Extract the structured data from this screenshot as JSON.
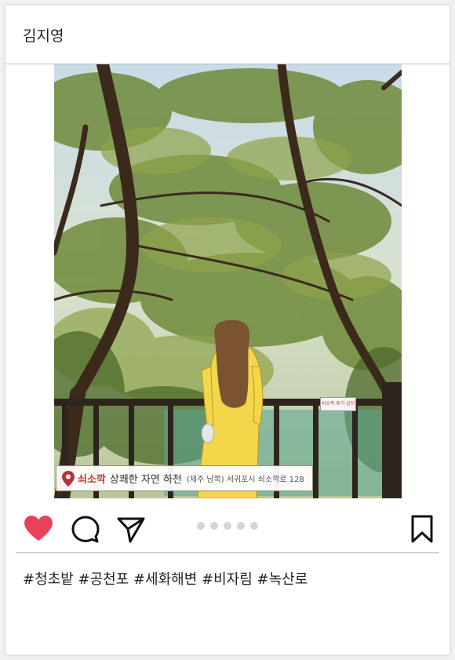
{
  "post": {
    "username": "김지영",
    "location": {
      "name": "쇠소깍",
      "description": "상쾌한 자연 하천",
      "region": "(제주 남쪽)",
      "address": "서귀포시 쇠소깍로 128"
    },
    "sign_text": "쇠소깍 투기 금지",
    "carousel": {
      "count": 5,
      "active": 1
    },
    "hashtags": "#청초밭 #공천포 #세화해변 #비자림 #녹산로",
    "liked": true
  },
  "colors": {
    "heart": "#e8425a",
    "dress": "#f3d64a",
    "hair": "#7a5330",
    "location_name": "#c0392b"
  },
  "icons": [
    "heart-icon",
    "comment-icon",
    "share-icon",
    "bookmark-icon",
    "location-pin-icon"
  ]
}
